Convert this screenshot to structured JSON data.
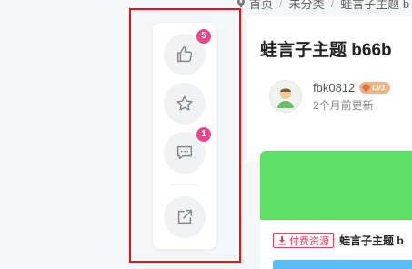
{
  "breadcrumb": {
    "home": "首页",
    "category": "未分类",
    "current": "蛙言子主题 b"
  },
  "action_bar": {
    "like": {
      "icon": "thumbs-up-icon",
      "count": "5"
    },
    "favorite": {
      "icon": "star-icon"
    },
    "comment": {
      "icon": "comment-icon",
      "count": "1"
    },
    "share": {
      "icon": "share-icon"
    }
  },
  "post": {
    "title": "蛙言子主题 b66b",
    "author": {
      "name": "fbk0812",
      "level": "LV1",
      "updated": "2个月前更新"
    }
  },
  "resource": {
    "tag": "付费资源",
    "title": "蛙言子主题 b"
  },
  "colors": {
    "highlight": "#e41414",
    "badge": "#e8488a",
    "banner": "#5ee066",
    "paid_tag": "#e0455e",
    "blue_bar": "#5cbcf5"
  }
}
